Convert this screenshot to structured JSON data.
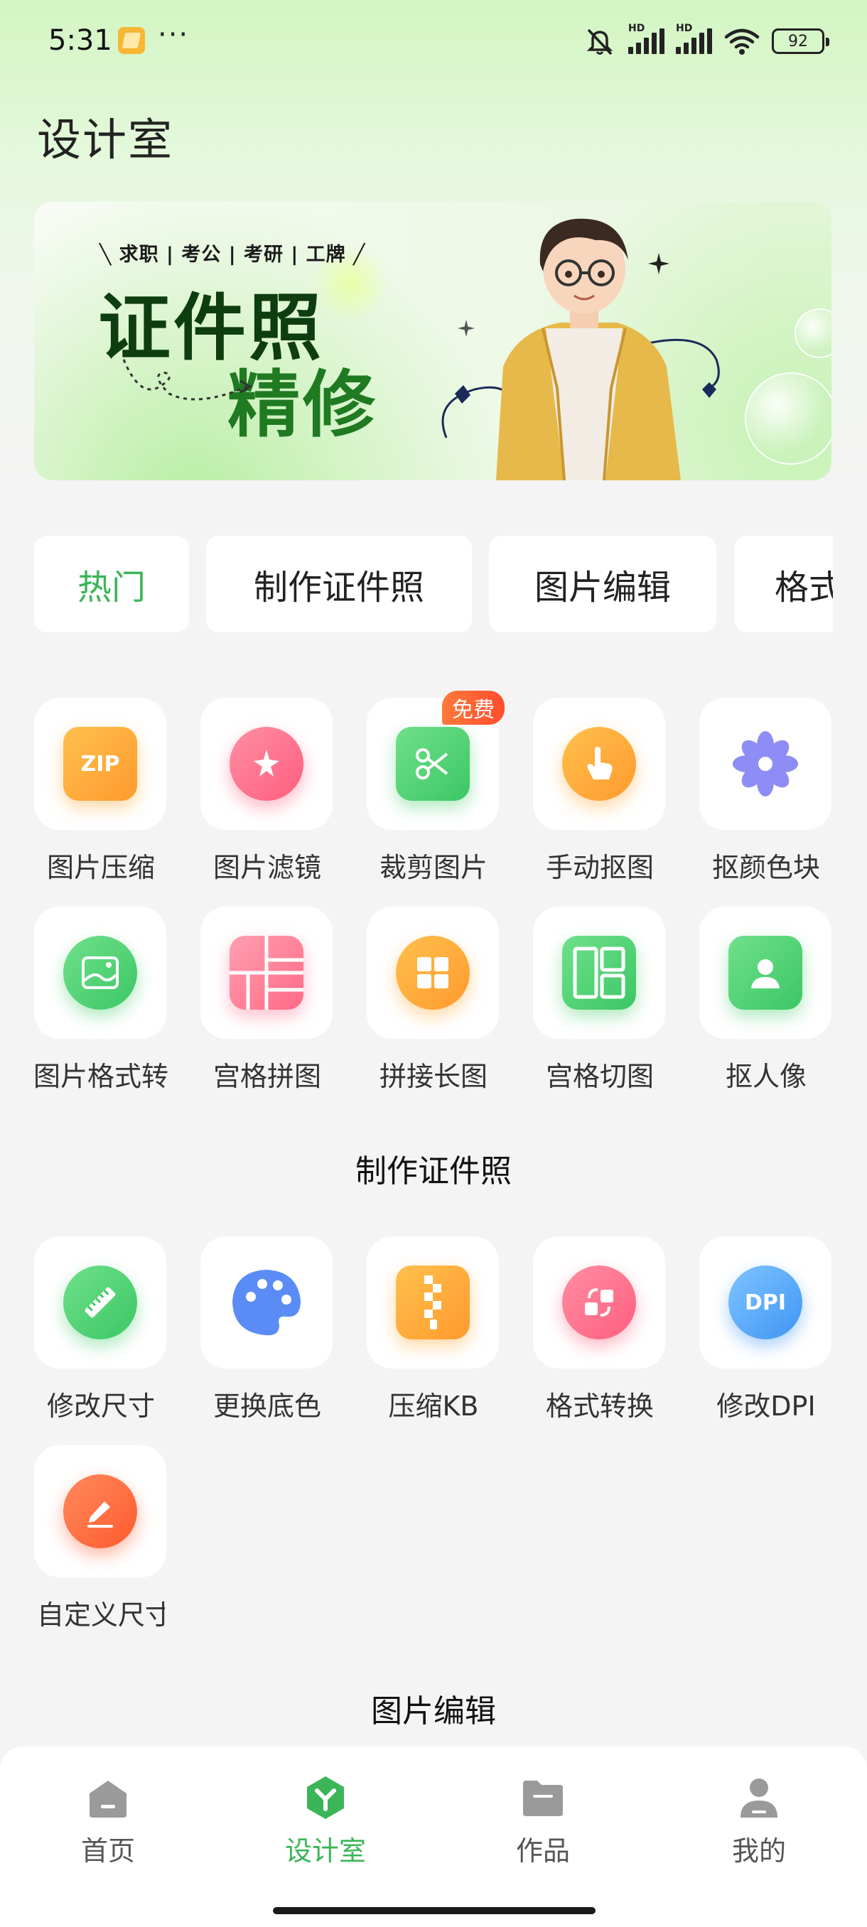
{
  "status_bar": {
    "time": "5:31",
    "more": "···",
    "battery": "92",
    "network_label_1": "HD",
    "network_label_2": "HD"
  },
  "page_title": "设计室",
  "banner": {
    "tags": "╲ 求职 | 考公 | 考研 | 工牌 ╱",
    "title_line1": "证件照",
    "title_line2": "精修"
  },
  "tabs": [
    {
      "label": "热门",
      "active": true
    },
    {
      "label": "制作证件照",
      "active": false
    },
    {
      "label": "图片编辑",
      "active": false
    },
    {
      "label": "格式",
      "active": false
    }
  ],
  "hot_tools": [
    {
      "label": "图片压缩",
      "icon": "zip-icon"
    },
    {
      "label": "图片滤镜",
      "icon": "filter-icon"
    },
    {
      "label": "裁剪图片",
      "icon": "crop-scissors-icon",
      "badge": "免费"
    },
    {
      "label": "手动抠图",
      "icon": "hand-pointer-icon"
    },
    {
      "label": "抠颜色块",
      "icon": "flower-icon"
    },
    {
      "label": "图片格式转",
      "icon": "image-format-icon"
    },
    {
      "label": "宫格拼图",
      "icon": "grid-collage-icon"
    },
    {
      "label": "拼接长图",
      "icon": "window-tiles-icon"
    },
    {
      "label": "宫格切图",
      "icon": "grid-split-icon"
    },
    {
      "label": "抠人像",
      "icon": "portrait-icon"
    }
  ],
  "section_id_photo": "制作证件照",
  "id_photo_tools": [
    {
      "label": "修改尺寸",
      "icon": "ruler-icon"
    },
    {
      "label": "更换底色",
      "icon": "palette-icon"
    },
    {
      "label": "压缩KB",
      "icon": "zipper-icon"
    },
    {
      "label": "格式转换",
      "icon": "convert-icon"
    },
    {
      "label": "修改DPI",
      "icon": "dpi-icon",
      "icon_text": "DPI"
    },
    {
      "label": "自定义尺寸",
      "icon": "edit-pen-icon"
    }
  ],
  "section_image_edit": "图片编辑",
  "bottom_nav": [
    {
      "label": "首页",
      "icon": "home-icon",
      "active": false
    },
    {
      "label": "设计室",
      "icon": "design-hex-icon",
      "active": true
    },
    {
      "label": "作品",
      "icon": "folder-icon",
      "active": false
    },
    {
      "label": "我的",
      "icon": "profile-icon",
      "active": false
    }
  ],
  "colors": {
    "accent": "#3bb558",
    "background": "#f4f4f4",
    "badge": "#ff5a30"
  }
}
